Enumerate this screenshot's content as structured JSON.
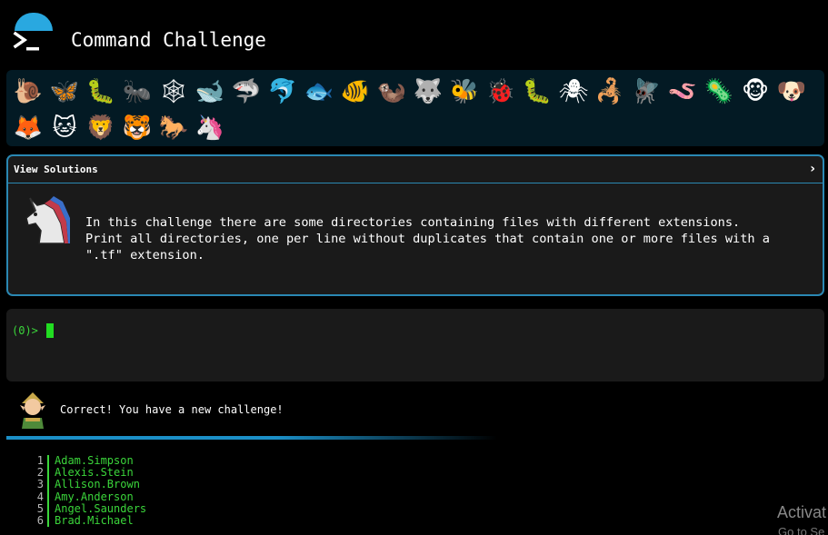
{
  "header": {
    "title": "Command Challenge"
  },
  "badges": [
    {
      "icon": "snail-icon",
      "glyph": "🐌"
    },
    {
      "icon": "butterfly-icon",
      "glyph": "🦋"
    },
    {
      "icon": "caterpillar-icon",
      "glyph": "🐛"
    },
    {
      "icon": "ant-icon",
      "glyph": "🐜"
    },
    {
      "icon": "spider-web-icon",
      "glyph": "🕸"
    },
    {
      "icon": "whale-icon",
      "glyph": "🐋"
    },
    {
      "icon": "shark-icon",
      "glyph": "🦈"
    },
    {
      "icon": "dolphin-icon",
      "glyph": "🐬"
    },
    {
      "icon": "fish-icon",
      "glyph": "🐟"
    },
    {
      "icon": "tropical-fish-icon",
      "glyph": "🐠"
    },
    {
      "icon": "otter-icon",
      "glyph": "🦦"
    },
    {
      "icon": "wolf-icon",
      "glyph": "🐺"
    },
    {
      "icon": "bee-icon",
      "glyph": "🐝"
    },
    {
      "icon": "ladybug-icon",
      "glyph": "🐞"
    },
    {
      "icon": "worm-icon",
      "glyph": "🐛"
    },
    {
      "icon": "spider-icon",
      "glyph": "🕷"
    },
    {
      "icon": "scorpion-icon",
      "glyph": "🦂"
    },
    {
      "icon": "fly-icon",
      "glyph": "🪰"
    },
    {
      "icon": "worm-pink-icon",
      "glyph": "🪱"
    },
    {
      "icon": "microbe-icon",
      "glyph": "🦠"
    },
    {
      "icon": "monkey-icon",
      "glyph": "🐵"
    },
    {
      "icon": "dog-icon",
      "glyph": "🐶"
    },
    {
      "icon": "fox-icon",
      "glyph": "🦊"
    },
    {
      "icon": "cat-icon",
      "glyph": "🐱"
    },
    {
      "icon": "lion-icon",
      "glyph": "🦁"
    },
    {
      "icon": "tiger-icon",
      "glyph": "🐯"
    },
    {
      "icon": "horse-icon",
      "glyph": "🐎"
    },
    {
      "icon": "unicorn-icon",
      "glyph": "🦄"
    }
  ],
  "solutions_panel": {
    "label": "View Solutions",
    "description": "In this challenge there are some directories containing files with different extensions.\nPrint all directories, one per line without duplicates that contain one or more files with a\n\".tf\" extension."
  },
  "terminal": {
    "prompt": "(0)>"
  },
  "feedback": {
    "message": "Correct! You have a new challenge!"
  },
  "output": [
    {
      "line": "1",
      "text": "Adam.Simpson"
    },
    {
      "line": "2",
      "text": "Alexis.Stein"
    },
    {
      "line": "3",
      "text": "Allison.Brown"
    },
    {
      "line": "4",
      "text": "Amy.Anderson"
    },
    {
      "line": "5",
      "text": "Angel.Saunders"
    },
    {
      "line": "6",
      "text": "Brad.Michael"
    }
  ],
  "watermark": {
    "line1": "Activat",
    "line2": "Go to Se"
  }
}
